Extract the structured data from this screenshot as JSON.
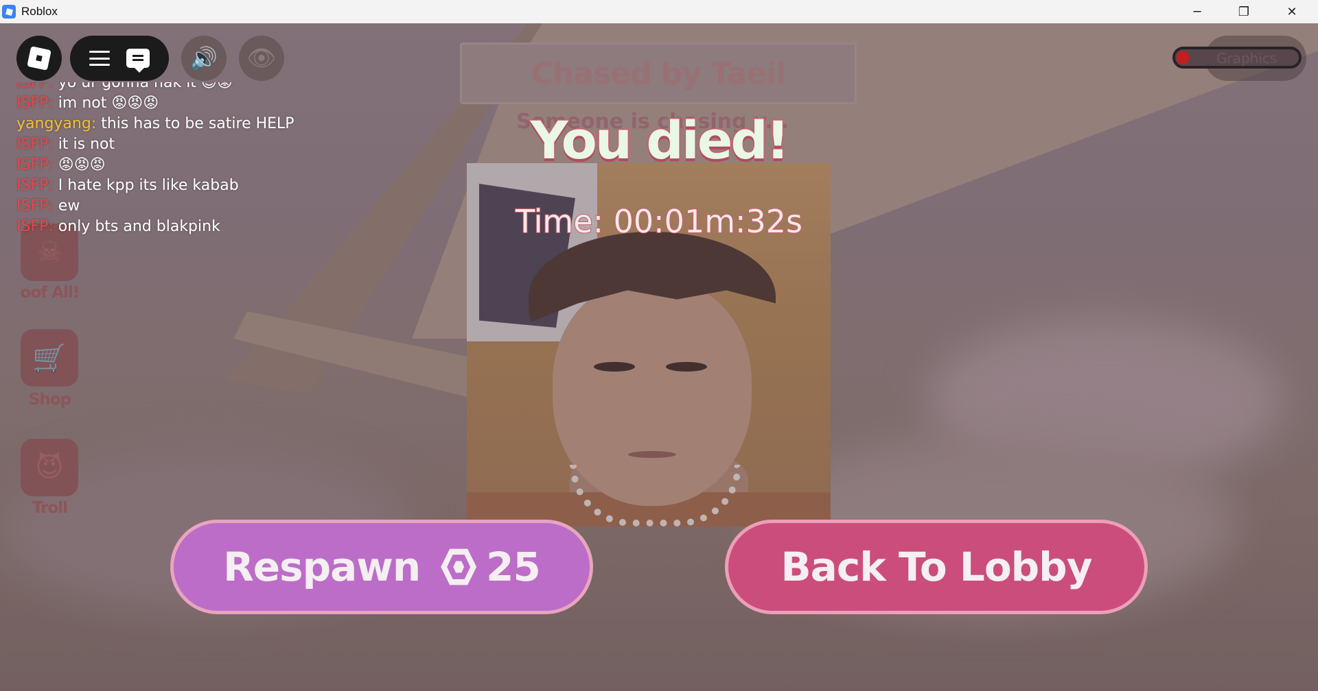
{
  "window": {
    "title": "Roblox",
    "minimize_glyph": "─",
    "maximize_glyph": "❐",
    "close_glyph": "✕"
  },
  "game": {
    "panel_title": "Chased by Taeil",
    "panel_subtitle": "Someone is chasing y..."
  },
  "side_buttons": [
    {
      "label": "oof All!",
      "icon": "skull-icon",
      "glyph": "☠"
    },
    {
      "label": "Shop",
      "icon": "cart-icon",
      "glyph": "🛒"
    },
    {
      "label": "Troll",
      "icon": "devil-icon",
      "glyph": "😈"
    }
  ],
  "graphics": {
    "label": "Graphics",
    "level": 0.1,
    "fill_color": "#e11616"
  },
  "chat": [
    {
      "user": "ISFP:",
      "user_color": "#e5484d",
      "message": "yo ur gonna nak it 😊😡",
      "clipped": true
    },
    {
      "user": "ISFP:",
      "user_color": "#e5484d",
      "message": "im not 😡😡😡"
    },
    {
      "user": "yangyang:",
      "user_color": "#f2c12e",
      "message": "this has to be satire HELP"
    },
    {
      "user": "ISFP:",
      "user_color": "#e5484d",
      "message": "it is not"
    },
    {
      "user": "ISFP:",
      "user_color": "#e5484d",
      "message": "😡😡😡"
    },
    {
      "user": "ISFP:",
      "user_color": "#e5484d",
      "message": "I hate kpp its like kabab"
    },
    {
      "user": "ISFP:",
      "user_color": "#e5484d",
      "message": "ew"
    },
    {
      "user": "ISFP:",
      "user_color": "#e5484d",
      "message": "only bts and blakpink"
    }
  ],
  "death": {
    "heading": "You died!",
    "time_text": "Time: 00:01m:32s"
  },
  "buttons": {
    "respawn_label": "Respawn",
    "respawn_cost": "25",
    "lobby_label": "Back To Lobby"
  },
  "colors": {
    "respawn": "#bc6dc7",
    "lobby": "#cb4d7c"
  }
}
